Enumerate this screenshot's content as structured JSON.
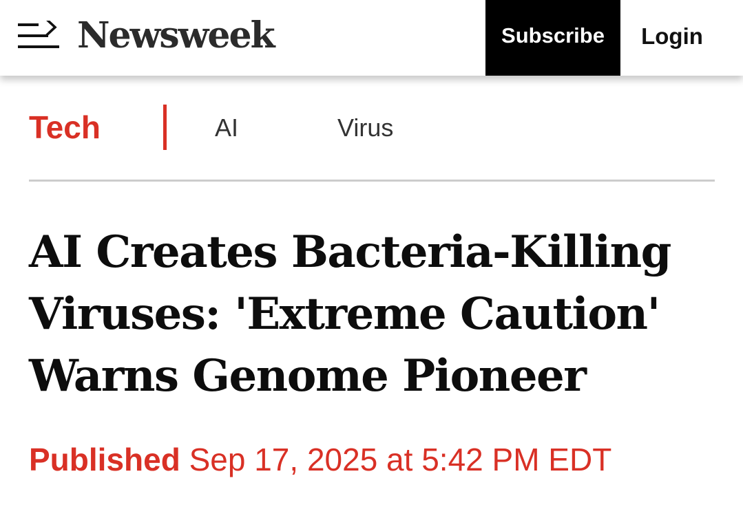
{
  "header": {
    "logo_text": "Newsweek",
    "subscribe_label": "Subscribe",
    "login_label": "Login",
    "menu_icon": "menu-arrow-icon"
  },
  "section": {
    "title": "Tech",
    "tags": [
      "AI",
      "Virus"
    ]
  },
  "article": {
    "headline": "AI Creates Bacteria-Killing Viruses: 'Extreme Caution' Warns Genome Pioneer",
    "published_label": "Published",
    "published_date": "Sep 17, 2025 at 5:42 PM EDT"
  },
  "colors": {
    "accent": "#d93025",
    "logo": "#2b2b2b",
    "subscribe_bg": "#000000",
    "divider": "#cccccc"
  }
}
